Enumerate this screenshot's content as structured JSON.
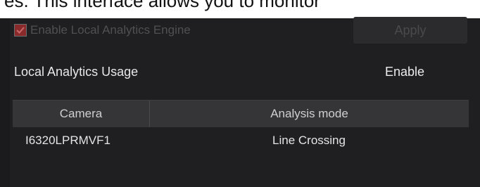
{
  "page_caption": "es. This interface allows you to monitor",
  "enable_engine": {
    "label": "Enable Local Analytics Engine",
    "checked": true,
    "disabled": true
  },
  "apply_button": {
    "label": "Apply",
    "disabled": true
  },
  "usage": {
    "label": "Local Analytics Usage",
    "value": "Enable"
  },
  "table": {
    "columns": [
      "Camera",
      "Analysis mode"
    ],
    "rows": [
      {
        "camera": "I6320LPRMVF1",
        "mode": "Line Crossing"
      }
    ]
  },
  "colors": {
    "background": "#1f1f22",
    "checkbox_fill": "#8a2a2a",
    "header_bg": "#353538"
  }
}
